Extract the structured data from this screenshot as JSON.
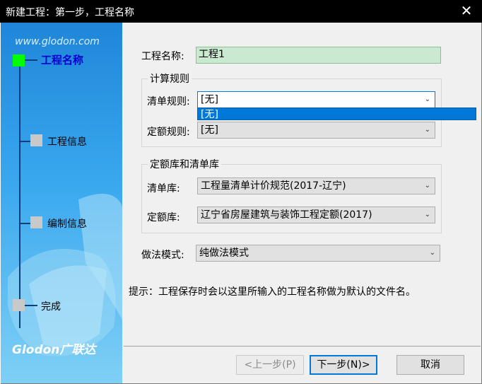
{
  "window": {
    "title": "新建工程：第一步，工程名称",
    "close_glyph": "✕"
  },
  "sidebar": {
    "site": "www.glodon.com",
    "steps": [
      {
        "label": "工程名称",
        "active": true
      },
      {
        "label": "工程信息",
        "active": false
      },
      {
        "label": "编制信息",
        "active": false
      },
      {
        "label": "完成",
        "active": false
      }
    ],
    "logo": "Glodon广联达"
  },
  "form": {
    "project_name_label": "工程名称:",
    "project_name_value": "工程1",
    "calc_rules_group": "计算规则",
    "bill_rule_label": "清单规则:",
    "bill_rule_value": "[无]",
    "bill_rule_dropdown_option": "[无]",
    "quota_rule_label": "定额规则:",
    "quota_rule_value": "[无]",
    "libs_group": "定额库和清单库",
    "bill_lib_label": "清单库:",
    "bill_lib_value": "工程量清单计价规范(2017-辽宁)",
    "quota_lib_label": "定额库:",
    "quota_lib_value": "辽宁省房屋建筑与装饰工程定额(2017)",
    "method_label": "做法模式:",
    "method_value": "纯做法模式"
  },
  "hint": "提示：工程保存时会以这里所输入的工程名称做为默认的文件名。",
  "buttons": {
    "prev": "<上一步(P)",
    "next": "下一步(N)>",
    "cancel": "取消"
  },
  "colors": {
    "active_step": "#00ff00",
    "active_step_text": "#0000d0",
    "selection": "#0078d7",
    "name_input_bg": "#c9ead0"
  },
  "icons": {
    "close": "close-icon",
    "dropdown": "chevron-down-icon"
  }
}
